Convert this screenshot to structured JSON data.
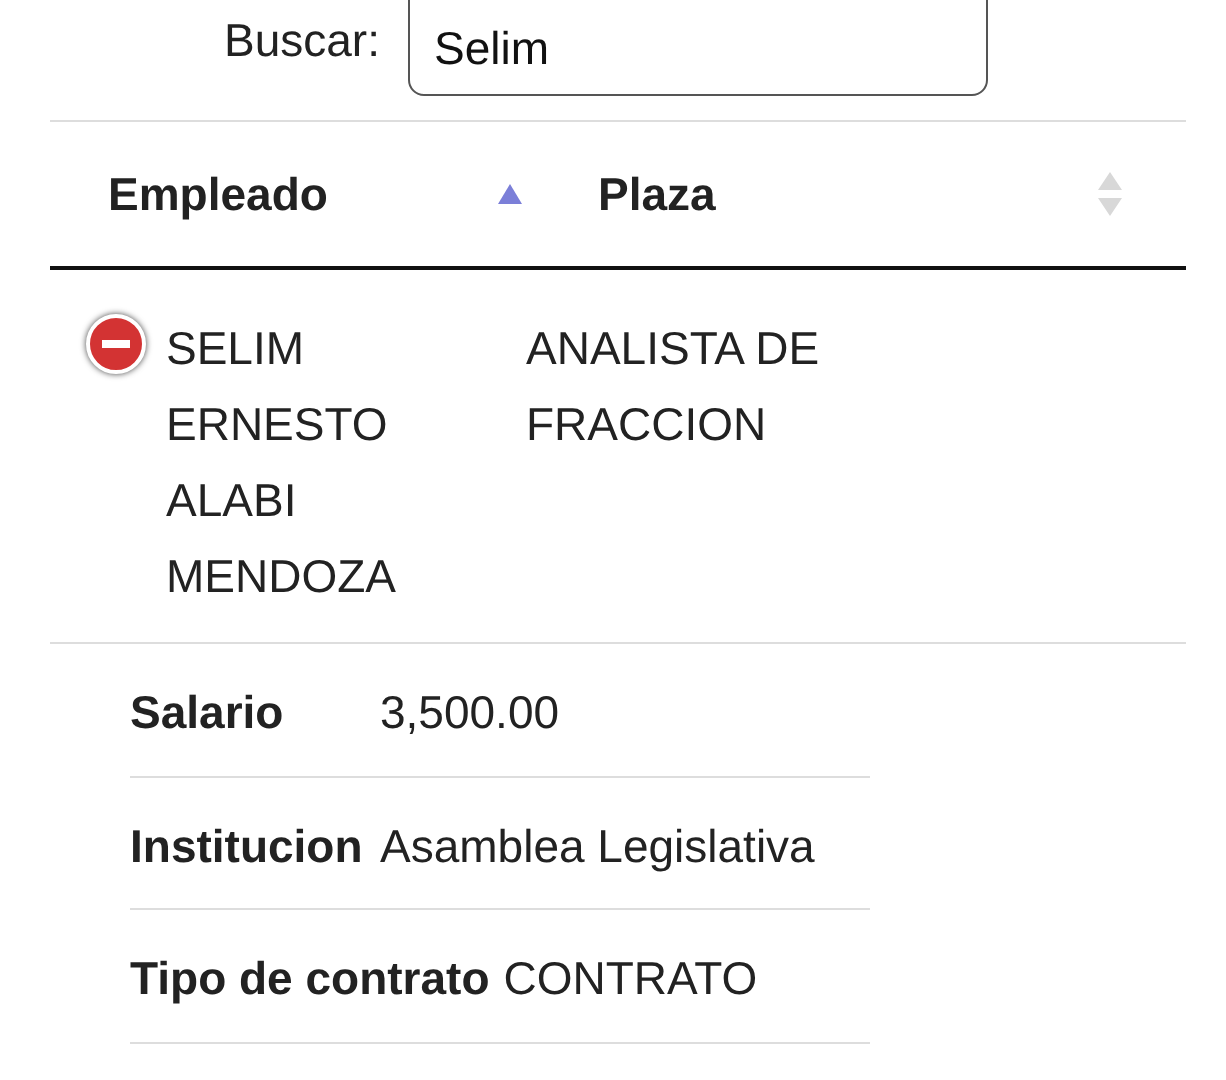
{
  "search": {
    "label": "Buscar:",
    "value": "Selim"
  },
  "table": {
    "columns": [
      {
        "label": "Empleado",
        "sorted_ascending": true
      },
      {
        "label": "Plaza",
        "sorted_ascending": false
      }
    ],
    "rows": [
      {
        "expanded": true,
        "cells": [
          "SELIM ERNESTO ALABI MENDOZA",
          "ANALISTA DE FRACCION"
        ],
        "details": [
          {
            "label": "Salario",
            "value": "3,500.00"
          },
          {
            "label": "Institucion",
            "value": "Asamblea Legislativa"
          },
          {
            "label": "Tipo de contrato",
            "value": "CONTRATO"
          }
        ]
      }
    ]
  }
}
